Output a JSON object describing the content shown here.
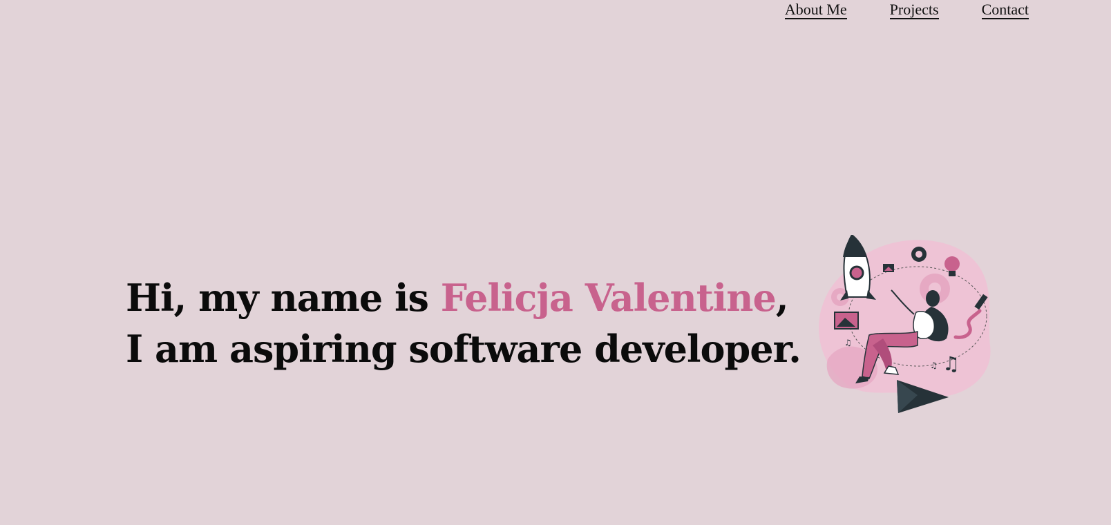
{
  "nav": {
    "items": [
      {
        "label": "About Me"
      },
      {
        "label": "Projects"
      },
      {
        "label": "Contact"
      }
    ]
  },
  "hero": {
    "line1_prefix": "Hi, my name is ",
    "name": "Felicja Valentine",
    "line1_suffix": ",",
    "line2": "I am aspiring software developer."
  },
  "illustration": {
    "icon": "astronaut-rocket-illustration"
  },
  "colors": {
    "background": "#e2d3d8",
    "accent": "#c8628d",
    "text": "#0b0b0b",
    "illustration_dark": "#263238",
    "illustration_pink": "#e8b4cb"
  }
}
